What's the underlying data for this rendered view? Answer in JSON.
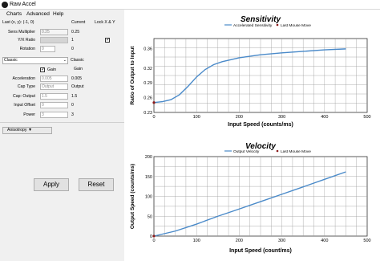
{
  "window": {
    "title": "Raw Accel"
  },
  "menu": {
    "charts": "Charts",
    "advanced": "Advanced",
    "help": "Help"
  },
  "panel": {
    "last_xy": "Last (x, y): (-1, 0)",
    "current_header": "Current",
    "lock_xy": "Lock X & Y",
    "sens_label": "Sens Multiplier",
    "sens_value": "0.25",
    "sens_current": "0.25",
    "yx_label": "Y/X Ratio",
    "yx_current": "1",
    "rotation_label": "Rotation",
    "rotation_value": "0",
    "rotation_current": "0",
    "mode_select": "Classic",
    "mode_current": "Classic",
    "gain_label": "Gain",
    "gain_current": "Gain",
    "accel_label": "Acceleration",
    "accel_value": "0.005",
    "accel_current": "0.005",
    "captype_label": "Cap Type",
    "captype_value": "Output",
    "captype_current": "Output",
    "capout_label": "Cap: Output",
    "capout_value": "1.5",
    "capout_current": "1.5",
    "offset_label": "Input Offset",
    "offset_value": "0",
    "offset_current": "0",
    "power_label": "Power",
    "power_value": "3",
    "power_current": "3",
    "anisotropy": "Anisotropy ▼",
    "apply": "Apply",
    "reset": "Reset"
  },
  "chart_data": [
    {
      "type": "line",
      "title": "Sensitivity",
      "xlabel": "Input Speed (counts/ms)",
      "ylabel": "Ratio of Output to Input",
      "xlim": [
        0,
        500
      ],
      "ylim": [
        0.23,
        0.38
      ],
      "xticks": [
        "0",
        "100",
        "200",
        "300",
        "400",
        "500"
      ],
      "yticks": [
        "0.23",
        "0.26",
        "0.29",
        "0.32",
        "0.36"
      ],
      "ytick_values": [
        0.23,
        0.26,
        0.29,
        0.32,
        0.36
      ],
      "grid": true,
      "legend": "top",
      "series": [
        {
          "name": "Accelerated Sensitivity",
          "color": "#4a8ac9",
          "x": [
            0,
            20,
            40,
            60,
            80,
            100,
            120,
            140,
            160,
            200,
            250,
            300,
            350,
            400,
            450
          ],
          "y": [
            0.25,
            0.252,
            0.256,
            0.266,
            0.283,
            0.302,
            0.317,
            0.327,
            0.333,
            0.341,
            0.347,
            0.351,
            0.354,
            0.357,
            0.359
          ]
        },
        {
          "name": "Last Mouse Move",
          "color": "#8b1a1a",
          "x": [
            0
          ],
          "y": [
            0.25
          ]
        }
      ]
    },
    {
      "type": "line",
      "title": "Velocity",
      "xlabel": "Input Speed (count/ms)",
      "ylabel": "Output Speed (counts/ms)",
      "xlim": [
        0,
        500
      ],
      "ylim": [
        0,
        200
      ],
      "xticks": [
        "0",
        "100",
        "200",
        "300",
        "400",
        "500"
      ],
      "yticks": [
        "0",
        "50",
        "100",
        "150",
        "200"
      ],
      "ytick_values": [
        0,
        50,
        100,
        150,
        200
      ],
      "grid": true,
      "legend": "top",
      "series": [
        {
          "name": "Output Velocity",
          "color": "#4a8ac9",
          "x": [
            0,
            50,
            100,
            150,
            200,
            250,
            300,
            350,
            400,
            450
          ],
          "y": [
            0,
            12.6,
            30.2,
            50,
            68.2,
            86.8,
            105.3,
            123.9,
            142.8,
            161.6
          ]
        },
        {
          "name": "Last Mouse Move",
          "color": "#8b1a1a",
          "x": [
            0
          ],
          "y": [
            0
          ]
        }
      ]
    }
  ]
}
